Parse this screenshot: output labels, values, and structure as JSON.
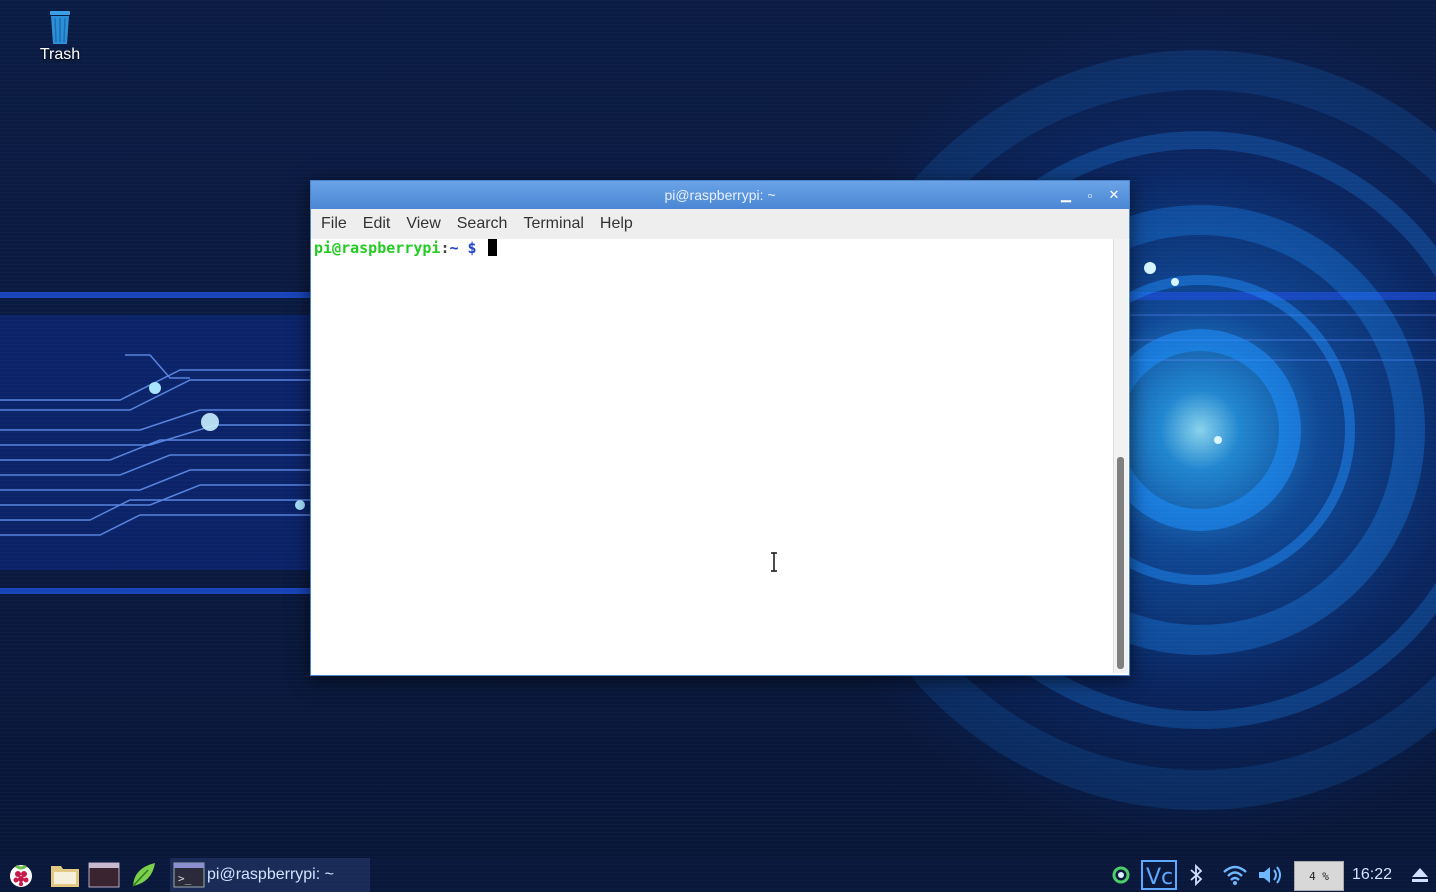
{
  "desktop": {
    "icons": [
      {
        "label": "Trash",
        "icon": "trash-icon"
      }
    ]
  },
  "terminal": {
    "title": "pi@raspberrypi: ~",
    "menu": [
      "File",
      "Edit",
      "View",
      "Search",
      "Terminal",
      "Help"
    ],
    "prompt": {
      "user_host": "pi@raspberrypi",
      "colon": ":",
      "path": "~ $",
      "input": ""
    },
    "colors": {
      "titlebar": "#5a95dc",
      "prompt_user": "#22cc22",
      "prompt_path": "#2244cc"
    }
  },
  "taskbar": {
    "launchers": [
      "raspberry-menu-icon",
      "file-manager-icon",
      "terminal-icon",
      "mathematica-icon"
    ],
    "task": {
      "label": "pi@raspberrypi: ~",
      "icon": "terminal-icon"
    },
    "tray": {
      "icons": [
        "update-icon",
        "vnc-icon",
        "bluetooth-icon",
        "wifi-icon",
        "volume-icon",
        "eject-icon"
      ],
      "cpu_usage": "4 %",
      "clock": "16:22"
    }
  }
}
